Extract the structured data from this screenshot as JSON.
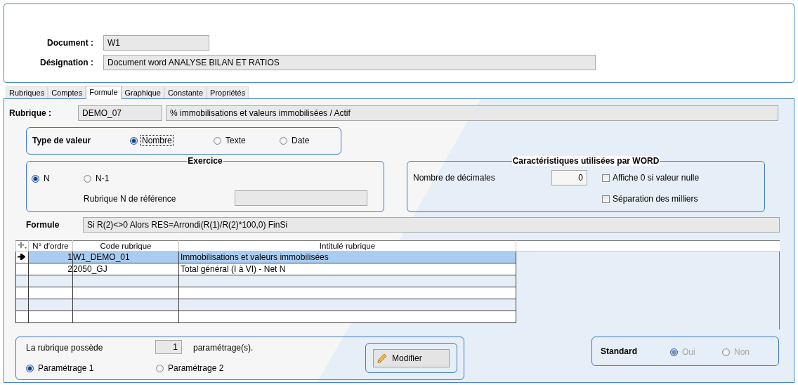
{
  "document": {
    "label": "Document :",
    "value": "W1"
  },
  "designation": {
    "label": "Désignation :",
    "value": "Document word ANALYSE BILAN ET RATIOS"
  },
  "tabs": [
    {
      "label": "Rubriques",
      "selected": false
    },
    {
      "label": "Comptes",
      "selected": false
    },
    {
      "label": "Formule",
      "selected": true
    },
    {
      "label": "Graphique",
      "selected": false
    },
    {
      "label": "Constante",
      "selected": false
    },
    {
      "label": "Propriétés",
      "selected": false
    }
  ],
  "rubrique": {
    "label": "Rubrique :",
    "code": "DEMO_07",
    "title": "% immobilisations et valeurs immobilisées / Actif"
  },
  "type_de_valeur": {
    "label": "Type de valeur",
    "options": [
      {
        "label": "Nombre",
        "selected": true,
        "focused": true
      },
      {
        "label": "Texte",
        "selected": false,
        "focused": false
      },
      {
        "label": "Date",
        "selected": false,
        "focused": false
      }
    ]
  },
  "exercice": {
    "title": "Exercice",
    "options": [
      {
        "label": "N",
        "selected": true
      },
      {
        "label": "N-1",
        "selected": false
      }
    ],
    "reference_label": "Rubrique N de référence"
  },
  "caracteristiques": {
    "title": "Caractéristiques utilisées par WORD",
    "decimals_label": "Nombre de décimales",
    "decimals": "0",
    "options": [
      {
        "label": "Affiche 0 si valeur nulle",
        "checked": false
      },
      {
        "label": "Séparation des milliers",
        "checked": false
      }
    ]
  },
  "formule": {
    "label": "Formule",
    "value": "Si R(2)<>0 Alors RES=Arrondi(R(1)/R(2)*100,0) FinSi"
  },
  "table": {
    "columns": [
      "N° d'ordre",
      "Code rubrique",
      "Intitulé rubrique"
    ],
    "rows": [
      {
        "cells": [
          "1",
          "W1_DEMO_01",
          "Immobilisations et valeurs immobilisées"
        ],
        "selected": true
      },
      {
        "cells": [
          "2",
          "2050_GJ",
          "Total général (I à VI) - Net N"
        ],
        "selected": false
      }
    ]
  },
  "parametrage": {
    "label": "La rubrique possède",
    "count": "1",
    "suffix": "paramétrage(s).",
    "options": [
      {
        "label": "Paramétrage 1",
        "selected": true
      },
      {
        "label": "Paramétrage 2",
        "selected": false
      }
    ],
    "button": "Modifier"
  },
  "standard": {
    "label": "Standard",
    "disabled": true,
    "options": [
      {
        "label": "Oui",
        "selected": true
      },
      {
        "label": "Non",
        "selected": false
      }
    ]
  }
}
